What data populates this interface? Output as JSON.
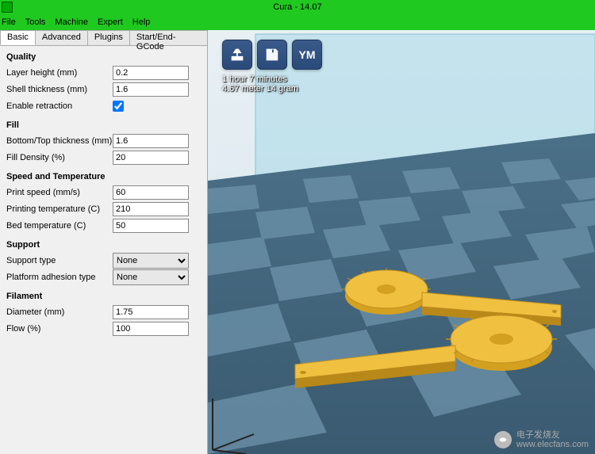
{
  "title": "Cura - 14.07",
  "menus": [
    "File",
    "Tools",
    "Machine",
    "Expert",
    "Help"
  ],
  "tabs": [
    "Basic",
    "Advanced",
    "Plugins",
    "Start/End-GCode"
  ],
  "active_tab": 0,
  "sections": {
    "quality": {
      "title": "Quality",
      "layer_height": {
        "label": "Layer height (mm)",
        "value": "0.2"
      },
      "shell_thickness": {
        "label": "Shell thickness (mm)",
        "value": "1.6"
      },
      "enable_retraction": {
        "label": "Enable retraction",
        "checked": true
      }
    },
    "fill": {
      "title": "Fill",
      "bottom_top": {
        "label": "Bottom/Top thickness (mm)",
        "value": "1.6"
      },
      "density": {
        "label": "Fill Density (%)",
        "value": "20"
      }
    },
    "speed_temp": {
      "title": "Speed and Temperature",
      "print_speed": {
        "label": "Print speed (mm/s)",
        "value": "60"
      },
      "print_temp": {
        "label": "Printing temperature (C)",
        "value": "210"
      },
      "bed_temp": {
        "label": "Bed temperature (C)",
        "value": "50"
      }
    },
    "support": {
      "title": "Support",
      "type": {
        "label": "Support type",
        "value": "None"
      },
      "adhesion": {
        "label": "Platform adhesion type",
        "value": "None"
      }
    },
    "filament": {
      "title": "Filament",
      "diameter": {
        "label": "Diameter (mm)",
        "value": "1.75"
      },
      "flow": {
        "label": "Flow (%)",
        "value": "100"
      }
    }
  },
  "toolbar_icons": {
    "load": "load-model-icon",
    "save": "save-icon",
    "ym": "YM"
  },
  "status": {
    "time": "1 hour 7 minutes",
    "material": "4.67 meter 14 gram"
  },
  "watermark": {
    "brand": "电子发烧友",
    "url": "www.elecfans.com"
  }
}
